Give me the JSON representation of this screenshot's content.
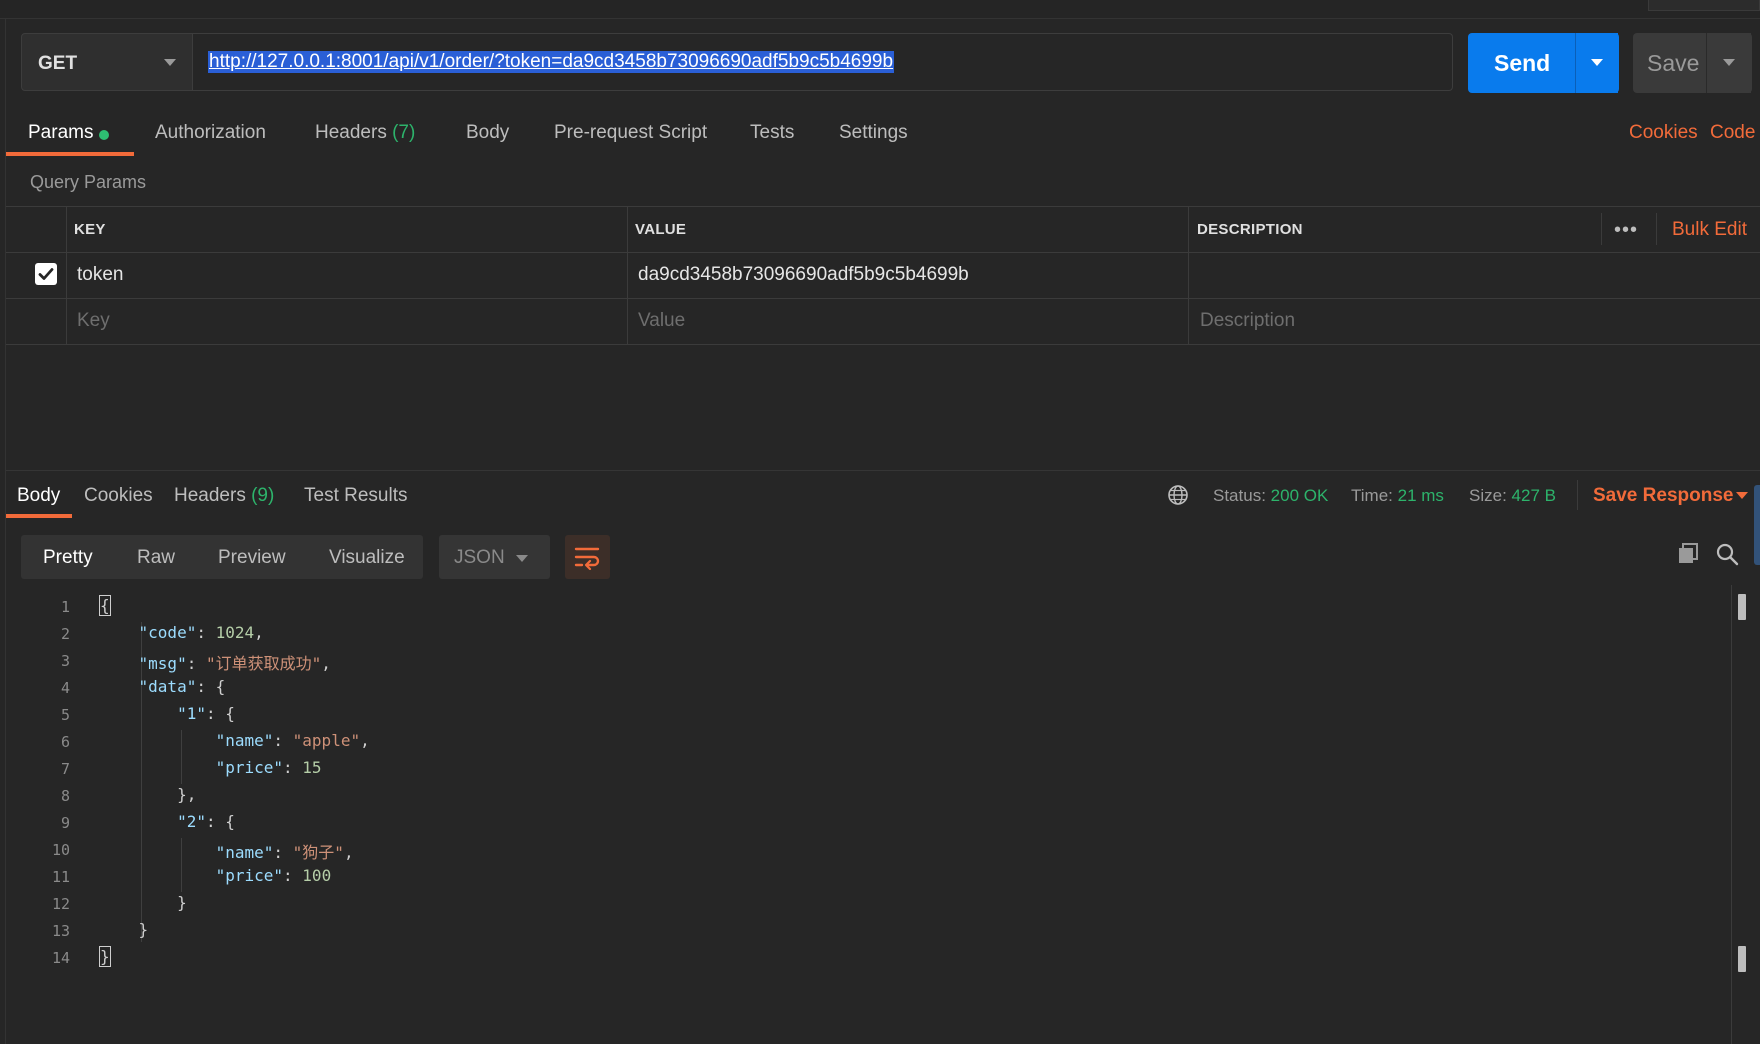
{
  "request": {
    "method": "GET",
    "url": "http://127.0.0.1:8001/api/v1/order/?token=da9cd3458b73096690adf5b9c5b4699b",
    "send_label": "Send",
    "save_label": "Save"
  },
  "request_tabs": {
    "params": "Params",
    "authorization": "Authorization",
    "headers": "Headers",
    "headers_count": "(7)",
    "body": "Body",
    "pre_request": "Pre-request Script",
    "tests": "Tests",
    "settings": "Settings",
    "cookies_link": "Cookies",
    "code_link": "Code"
  },
  "query_params": {
    "title": "Query Params",
    "columns": [
      "KEY",
      "VALUE",
      "DESCRIPTION"
    ],
    "bulk_edit": "Bulk Edit",
    "more": "•••",
    "rows": [
      {
        "key": "token",
        "value": "da9cd3458b73096690adf5b9c5b4699b",
        "description": "",
        "checked": true
      }
    ],
    "placeholders": {
      "key": "Key",
      "value": "Value",
      "description": "Description"
    }
  },
  "response_tabs": {
    "body": "Body",
    "cookies": "Cookies",
    "headers": "Headers",
    "headers_count": "(9)",
    "test_results": "Test Results"
  },
  "response_meta": {
    "status_label": "Status:",
    "status_value": "200 OK",
    "time_label": "Time:",
    "time_value": "21 ms",
    "size_label": "Size:",
    "size_value": "427 B",
    "save_response": "Save Response"
  },
  "view_modes": [
    "Pretty",
    "Raw",
    "Preview",
    "Visualize"
  ],
  "format": "JSON",
  "icons": {
    "globe": "globe-icon",
    "wrap": "wrap-lines-icon",
    "copy": "copy-icon",
    "search": "search-icon",
    "check": "check-icon"
  },
  "colors": {
    "accent": "#f26b3a",
    "send": "#097bed",
    "success": "#2db36b"
  },
  "code": {
    "line_numbers": [
      "1",
      "2",
      "3",
      "4",
      "5",
      "6",
      "7",
      "8",
      "9",
      "10",
      "11",
      "12",
      "13",
      "14"
    ],
    "open_brace": "{",
    "close_brace": "}",
    "code_key": "\"code\"",
    "code_val": "1024",
    "msg_key": "\"msg\"",
    "msg_val": "\"订单获取成功\"",
    "data_key": "\"data\"",
    "k1": "\"1\"",
    "k2": "\"2\"",
    "name_key": "\"name\"",
    "price_key": "\"price\"",
    "item1_name": "\"apple\"",
    "item1_price": "15",
    "item2_name": "\"狗子\"",
    "item2_price": "100"
  }
}
